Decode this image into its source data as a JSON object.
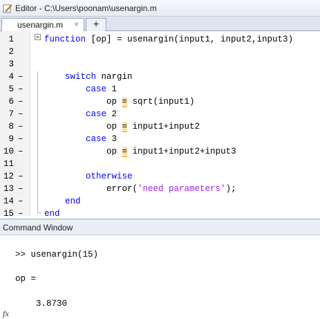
{
  "window": {
    "title": "Editor - C:\\Users\\poonam\\usenargin.m"
  },
  "tabs": [
    {
      "label": "usenargin.m",
      "close": "×"
    }
  ],
  "add_tab": "+",
  "editor": {
    "lines": [
      {
        "num": "1",
        "dash": "",
        "segs": [
          {
            "t": "function",
            "c": "kw"
          },
          {
            "t": " [op] = usenargin(input1, input2,input3)",
            "c": ""
          }
        ]
      },
      {
        "num": "2",
        "dash": "",
        "segs": []
      },
      {
        "num": "3",
        "dash": "",
        "segs": []
      },
      {
        "num": "4",
        "dash": "–",
        "segs": [
          {
            "t": "    ",
            "c": ""
          },
          {
            "t": "switch",
            "c": "kw"
          },
          {
            "t": " nargin",
            "c": ""
          }
        ]
      },
      {
        "num": "5",
        "dash": "–",
        "segs": [
          {
            "t": "        ",
            "c": ""
          },
          {
            "t": "case",
            "c": "kw"
          },
          {
            "t": " 1",
            "c": ""
          }
        ]
      },
      {
        "num": "6",
        "dash": "–",
        "segs": [
          {
            "t": "            op ",
            "c": ""
          },
          {
            "t": "=",
            "c": "warn"
          },
          {
            "t": " sqrt(input1)",
            "c": ""
          }
        ]
      },
      {
        "num": "7",
        "dash": "–",
        "segs": [
          {
            "t": "        ",
            "c": ""
          },
          {
            "t": "case",
            "c": "kw"
          },
          {
            "t": " 2",
            "c": ""
          }
        ]
      },
      {
        "num": "8",
        "dash": "–",
        "segs": [
          {
            "t": "            op ",
            "c": ""
          },
          {
            "t": "=",
            "c": "warn"
          },
          {
            "t": " input1+input2",
            "c": ""
          }
        ]
      },
      {
        "num": "9",
        "dash": "–",
        "segs": [
          {
            "t": "        ",
            "c": ""
          },
          {
            "t": "case",
            "c": "kw"
          },
          {
            "t": " 3",
            "c": ""
          }
        ]
      },
      {
        "num": "10",
        "dash": "–",
        "segs": [
          {
            "t": "            op ",
            "c": ""
          },
          {
            "t": "=",
            "c": "warn"
          },
          {
            "t": " input1+input2+input3",
            "c": ""
          }
        ]
      },
      {
        "num": "11",
        "dash": "",
        "segs": []
      },
      {
        "num": "12",
        "dash": "–",
        "segs": [
          {
            "t": "        ",
            "c": ""
          },
          {
            "t": "otherwise",
            "c": "kw"
          }
        ]
      },
      {
        "num": "13",
        "dash": "–",
        "segs": [
          {
            "t": "            error(",
            "c": ""
          },
          {
            "t": "'need parameters'",
            "c": "str"
          },
          {
            "t": ");",
            "c": ""
          }
        ]
      },
      {
        "num": "14",
        "dash": "–",
        "segs": [
          {
            "t": "    ",
            "c": ""
          },
          {
            "t": "end",
            "c": "kw"
          }
        ]
      },
      {
        "num": "15",
        "dash": "–",
        "segs": [
          {
            "t": "end",
            "c": "kw"
          }
        ]
      }
    ]
  },
  "command_window": {
    "title": "Command Window",
    "lines": [
      ">> usenargin(15)",
      "op =",
      "    3.8730"
    ],
    "prompt_icon": "fx"
  }
}
